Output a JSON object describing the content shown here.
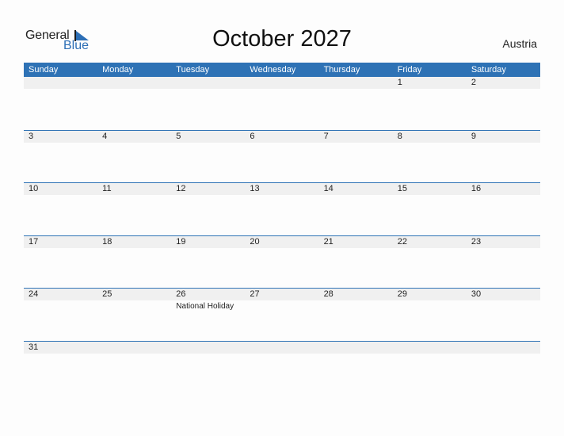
{
  "brand": {
    "word1": "General",
    "word2": "Blue",
    "accent_color": "#2e72b5"
  },
  "title": "October 2027",
  "country": "Austria",
  "weekdays": [
    "Sunday",
    "Monday",
    "Tuesday",
    "Wednesday",
    "Thursday",
    "Friday",
    "Saturday"
  ],
  "weeks": [
    [
      {
        "day": ""
      },
      {
        "day": ""
      },
      {
        "day": ""
      },
      {
        "day": ""
      },
      {
        "day": ""
      },
      {
        "day": "1"
      },
      {
        "day": "2"
      }
    ],
    [
      {
        "day": "3"
      },
      {
        "day": "4"
      },
      {
        "day": "5"
      },
      {
        "day": "6"
      },
      {
        "day": "7"
      },
      {
        "day": "8"
      },
      {
        "day": "9"
      }
    ],
    [
      {
        "day": "10"
      },
      {
        "day": "11"
      },
      {
        "day": "12"
      },
      {
        "day": "13"
      },
      {
        "day": "14"
      },
      {
        "day": "15"
      },
      {
        "day": "16"
      }
    ],
    [
      {
        "day": "17"
      },
      {
        "day": "18"
      },
      {
        "day": "19"
      },
      {
        "day": "20"
      },
      {
        "day": "21"
      },
      {
        "day": "22"
      },
      {
        "day": "23"
      }
    ],
    [
      {
        "day": "24"
      },
      {
        "day": "25"
      },
      {
        "day": "26",
        "event": "National Holiday"
      },
      {
        "day": "27"
      },
      {
        "day": "28"
      },
      {
        "day": "29"
      },
      {
        "day": "30"
      }
    ],
    [
      {
        "day": "31"
      },
      {
        "day": ""
      },
      {
        "day": ""
      },
      {
        "day": ""
      },
      {
        "day": ""
      },
      {
        "day": ""
      },
      {
        "day": ""
      }
    ]
  ]
}
